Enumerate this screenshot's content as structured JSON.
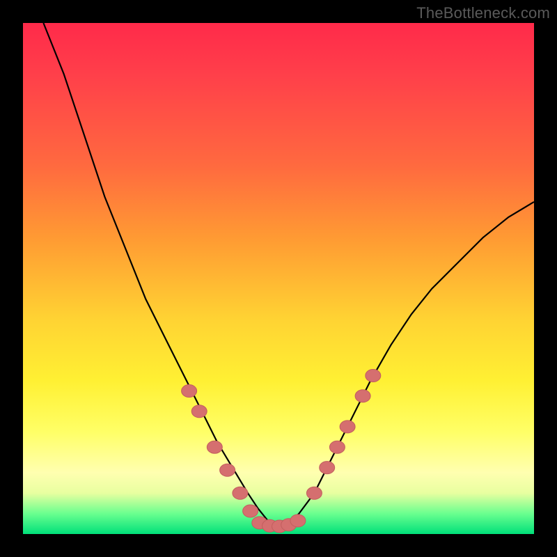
{
  "watermark": "TheBottleneck.com",
  "colors": {
    "frame": "#000000",
    "curve": "#000000",
    "marker_fill": "#d56f6f",
    "marker_stroke": "#c25e5e"
  },
  "chart_data": {
    "type": "line",
    "title": "",
    "xlabel": "",
    "ylabel": "",
    "xlim": [
      0,
      100
    ],
    "ylim": [
      0,
      100
    ],
    "grid": false,
    "legend": false,
    "note": "Bottleneck-style V-curve. Axes/ticks not labeled in image; values are estimated pixel-derived percentages.",
    "series": [
      {
        "name": "curve",
        "x": [
          4,
          8,
          12,
          16,
          20,
          24,
          28,
          32,
          35,
          38,
          41,
          44,
          46,
          48,
          50,
          52,
          54,
          57,
          60,
          64,
          68,
          72,
          76,
          80,
          85,
          90,
          95,
          100
        ],
        "y": [
          100,
          90,
          78,
          66,
          56,
          46,
          38,
          30,
          24,
          18,
          13,
          8,
          5,
          2.5,
          1.5,
          2,
          4,
          8,
          14,
          22,
          30,
          37,
          43,
          48,
          53,
          58,
          62,
          65
        ]
      }
    ],
    "markers": {
      "name": "highlighted-points",
      "note": "Pink oval markers clustered near curve minimum (lower flanks and bottom).",
      "points": [
        {
          "x": 32.5,
          "y": 28
        },
        {
          "x": 34.5,
          "y": 24
        },
        {
          "x": 37.5,
          "y": 17
        },
        {
          "x": 40.0,
          "y": 12.5
        },
        {
          "x": 42.5,
          "y": 8
        },
        {
          "x": 44.5,
          "y": 4.5
        },
        {
          "x": 46.3,
          "y": 2.2
        },
        {
          "x": 48.3,
          "y": 1.6
        },
        {
          "x": 50.2,
          "y": 1.5
        },
        {
          "x": 52.0,
          "y": 1.8
        },
        {
          "x": 53.8,
          "y": 2.6
        },
        {
          "x": 57.0,
          "y": 8
        },
        {
          "x": 59.5,
          "y": 13
        },
        {
          "x": 61.5,
          "y": 17
        },
        {
          "x": 63.5,
          "y": 21
        },
        {
          "x": 66.5,
          "y": 27
        },
        {
          "x": 68.5,
          "y": 31
        }
      ]
    }
  }
}
